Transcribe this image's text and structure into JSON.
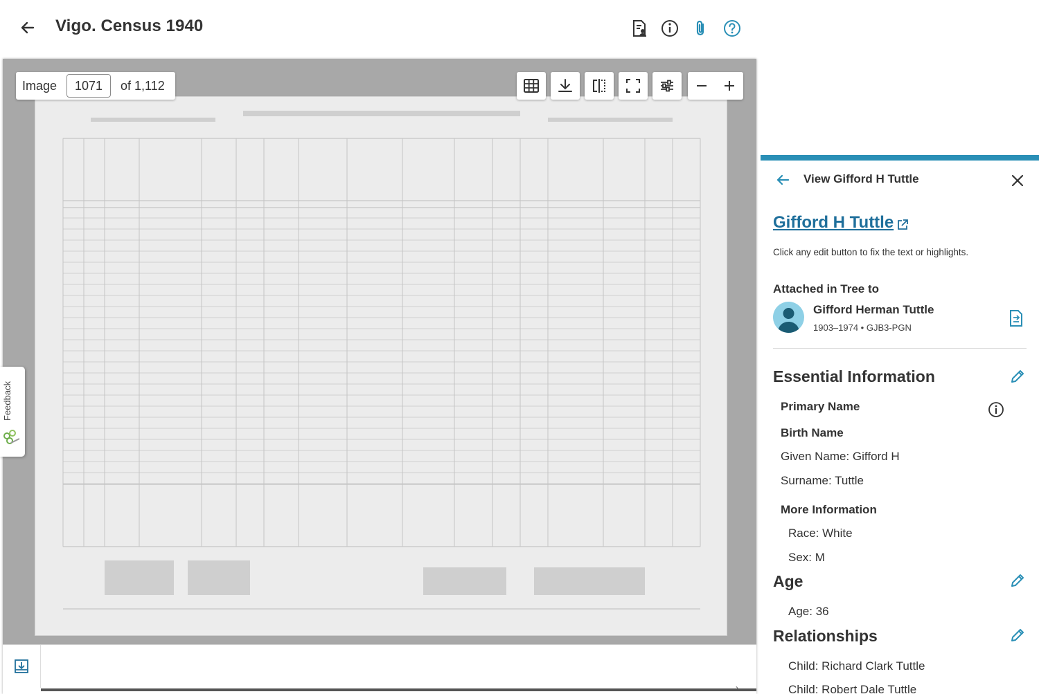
{
  "header": {
    "title": "Vigo. Census 1940"
  },
  "viewer": {
    "image_label": "Image",
    "image_number": "1071",
    "image_total": "of 1,112"
  },
  "feedback": {
    "label": "Feedback"
  },
  "panel": {
    "title": "View Gifford H Tuttle",
    "person_link": "Gifford H Tuttle",
    "hint": "Click any edit button to fix the text or highlights.",
    "attached_heading": "Attached in Tree to",
    "tree_person": {
      "name": "Gifford Herman Tuttle",
      "meta": "1903–1974 • GJB3-PGN"
    },
    "essential": {
      "heading": "Essential Information",
      "primary_name": "Primary Name",
      "birth_name": "Birth Name",
      "given_name": "Given Name: Gifford H",
      "surname": "Surname: Tuttle",
      "more_info": "More Information",
      "race": "Race: White",
      "sex": "Sex: M"
    },
    "age": {
      "heading": "Age",
      "value": "Age: 36"
    },
    "relationships": {
      "heading": "Relationships",
      "items": [
        "Child: Richard Clark Tuttle",
        "Child: Robert Dale Tuttle"
      ]
    }
  },
  "colors": {
    "accent": "#2a8fb6",
    "link": "#1f6f9b",
    "text": "#333333"
  }
}
